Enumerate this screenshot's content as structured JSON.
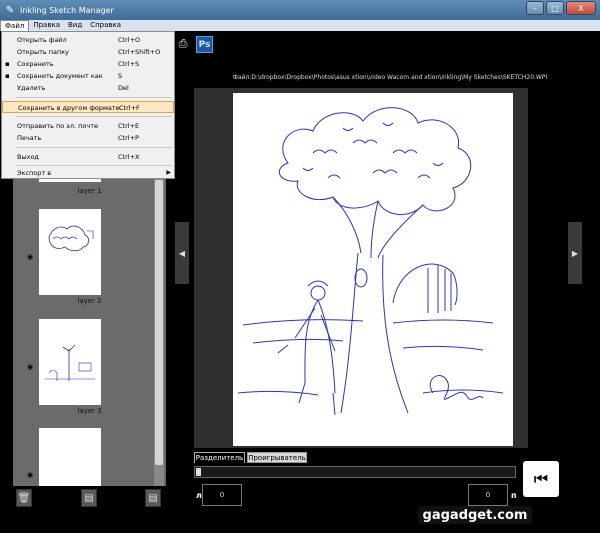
{
  "window": {
    "title": "Inkling Sketch Manager",
    "controls": {
      "minimize": "–",
      "maximize": "□",
      "close": "X"
    }
  },
  "menubar": [
    "Файл",
    "Правка",
    "Вид",
    "Справка"
  ],
  "file_menu": [
    {
      "label": "Открыть файл",
      "shortcut": "Ctrl+O"
    },
    {
      "label": "Открыть папку",
      "shortcut": "Ctrl+Shift+O"
    },
    {
      "label": "Сохранить",
      "shortcut": "Ctrl+S",
      "icon": "save-icon"
    },
    {
      "label": "Сохранить документ как",
      "shortcut": "S",
      "icon": "save-as-icon"
    },
    {
      "label": "Удалить",
      "shortcut": "Del"
    },
    {
      "label": "Сохранить в другом формате",
      "shortcut": "Ctrl+F",
      "highlighted": true
    },
    {
      "label": "Отправить по эл. почте",
      "shortcut": "Ctrl+E"
    },
    {
      "label": "Печать",
      "shortcut": "Ctrl+P"
    },
    {
      "label": "Выход",
      "shortcut": "Ctrl+X"
    },
    {
      "label": "Экспорт в",
      "shortcut": "",
      "submenu": true
    }
  ],
  "toolbar": {
    "ps_label": "Ps"
  },
  "file_path": "Файл:D:\\dropbox\\Dropbox\\Photos\\asus xtion\\video Wacom and xtion\\inkling\\My Sketches\\SKETCH20.WPI",
  "layers": [
    {
      "label": "layer 1"
    },
    {
      "label": "layer 2"
    },
    {
      "label": "layer 3"
    }
  ],
  "tabs": {
    "active": "Разделитель",
    "inactive": "Проигрыватель"
  },
  "bottom": {
    "left_label": "л",
    "left_value": "0",
    "right_label": "п",
    "right_value": "0"
  },
  "watermark": "gagadget.com",
  "colors": {
    "titlebar": "#4f7ea8",
    "menu_highlight": "#fbe8c2",
    "ps_blue": "#1c5aa0"
  }
}
